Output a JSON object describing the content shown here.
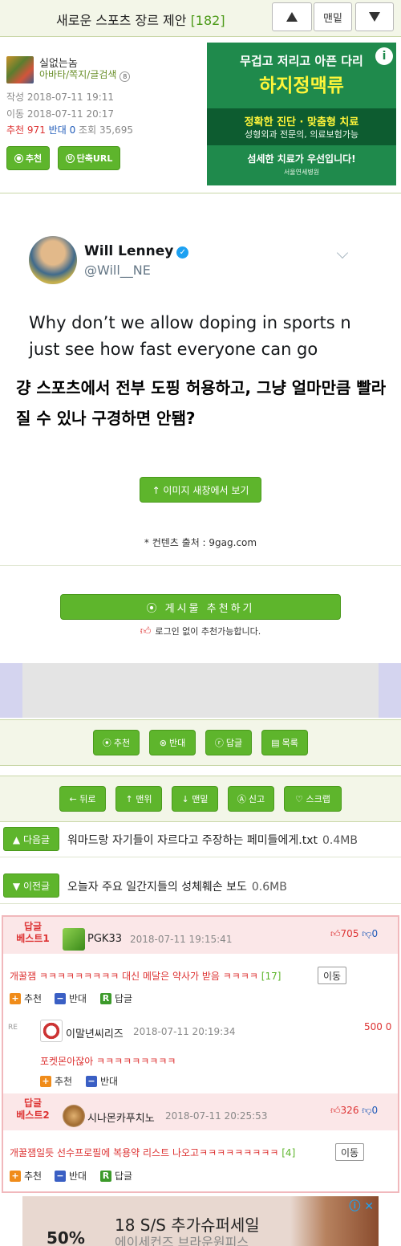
{
  "header": {
    "title": "새로운 스포츠 장르 제안",
    "count": "[182]",
    "up_icon": "triangle-up",
    "bottom_label": "맨밑",
    "down_icon": "triangle-down"
  },
  "meta": {
    "nickname": "실없는놈",
    "links": "아바타/쪽지/글검색",
    "level_badge": "8",
    "written_label": "작성 2018-07-11 19:11",
    "moved_label": "이동 2018-07-11 20:17",
    "rec_label": "추천",
    "rec_value": "971",
    "opp_label": "반대",
    "opp_value": "0",
    "views_label": "조회",
    "views_value": "35,695",
    "btn_recommend": "추천",
    "btn_short_url": "단축URL"
  },
  "ad_top": {
    "line1": "무겁고 저리고 아픈 다리",
    "line2": "하지정맥류",
    "line3": "정확한 진단 · 맞춤형 치료",
    "line4": "성형외과 전문의, 의료보험가능",
    "line5": "섬세한 치료가 우선입니다!",
    "line6": "서울연세병원",
    "info": "i"
  },
  "tweet": {
    "name": "Will Lenney",
    "handle": "@Will__NE",
    "text": "Why don’t we allow doping in sports n just see how fast everyone can go"
  },
  "post": {
    "caption": "걍 스포츠에서 전부 도핑 허용하고, 그냥 얼마만큼 빨라질 수 있나 구경하면 안됌?",
    "view_image_btn": "↑ 이미지 새창에서 보기",
    "source": "* 컨텐츠 출처 : 9gag.com",
    "recommend_post_btn": "게시물 추천하기",
    "recommend_note": "로그인 없이 추천가능합니다."
  },
  "actions1": [
    "추천",
    "반대",
    "답글",
    "목록"
  ],
  "actions2": [
    "← 뒤로",
    "↑ 맨위",
    "↓ 맨밑",
    "신고",
    "♡ 스크랩"
  ],
  "next_post": {
    "label": "▲ 다음글",
    "title": "워마드랑 자기들이 자르다고 주장하는 페미들에게.txt",
    "size": "0.4MB"
  },
  "prev_post": {
    "label": "▼ 이전글",
    "title": "오늘자 주요 일간지들의 성체훼손 보도",
    "size": "0.6MB"
  },
  "best_comments": [
    {
      "label_line1": "답글",
      "label_line2": "베스트1",
      "name": "PGK33",
      "date": "2018-07-11 19:15:41",
      "up": "705",
      "down": "0",
      "text": "개꿀잼 ㅋㅋㅋㅋㅋㅋㅋㅋㅋ 대신 메달은 약사가 받음 ㅋㅋㅋㅋ",
      "reply_count": "[17]",
      "move": "이동",
      "btn_rec": "추천",
      "btn_opp": "반대",
      "btn_reply": "답글"
    },
    {
      "re": "RE",
      "name": "이말년씨리즈",
      "date": "2018-07-11 20:19:34",
      "score": "500 0",
      "text": "포켓몬아잖아 ㅋㅋㅋㅋㅋㅋㅋㅋㅋ",
      "btn_rec": "추천",
      "btn_opp": "반대"
    },
    {
      "label_line1": "답글",
      "label_line2": "베스트2",
      "name": "시나몬카푸치노",
      "date": "2018-07-11 20:25:53",
      "up": "326",
      "down": "0",
      "text": "개꿀잼일듯 선수프로필에 복용약 리스트 나오고ㅋㅋㅋㅋㅋㅋㅋㅋㅋ",
      "reply_count": "[4]",
      "move": "이동",
      "btn_rec": "추천",
      "btn_opp": "반대",
      "btn_reply": "답글"
    }
  ],
  "ad_bottom": {
    "pct": "50%",
    "line1": "18 S/S 추가슈퍼세일",
    "line2": "에이세컨즈 브라운원피스"
  },
  "colors": {
    "accent_green": "#5eb52c",
    "best_red": "#d33",
    "down_blue": "#1e5ab8"
  }
}
